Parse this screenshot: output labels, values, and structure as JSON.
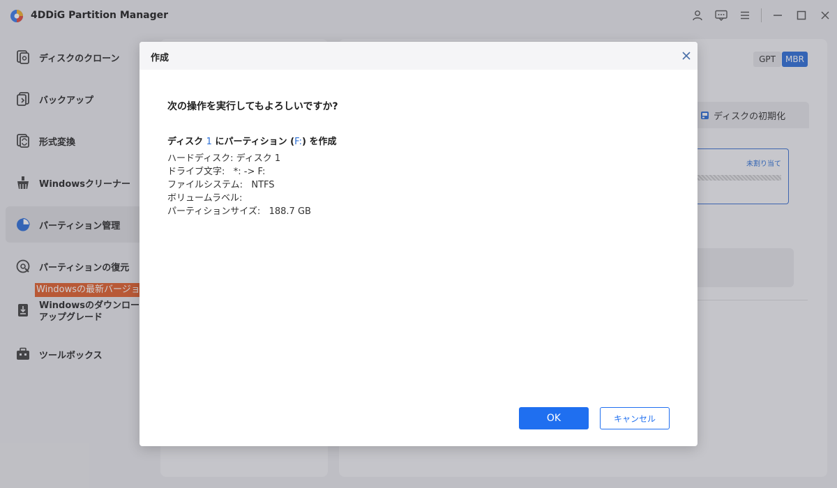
{
  "app": {
    "title": "4DDiG Partition Manager"
  },
  "titlebar_icons": [
    "user-icon",
    "feedback-icon",
    "menu-icon",
    "minimize-icon",
    "maximize-icon",
    "close-icon"
  ],
  "sidebar": {
    "items": [
      {
        "label": "ディスクのクローン",
        "icon": "disk-clone-icon"
      },
      {
        "label": "バックアップ",
        "icon": "backup-icon"
      },
      {
        "label": "形式変換",
        "icon": "format-convert-icon"
      },
      {
        "label": "Windowsクリーナー",
        "icon": "cleaner-icon"
      },
      {
        "label": "パーティション管理",
        "icon": "partition-pie-icon",
        "active": true
      },
      {
        "label": "パーティションの復元",
        "icon": "partition-recover-icon"
      },
      {
        "label_line1": "Windowsのダウンロード&",
        "label_line2": "アップグレード",
        "icon": "windows-download-icon"
      },
      {
        "label": "ツールボックス",
        "icon": "toolbox-icon"
      }
    ],
    "promo_badge": "Windowsの最新バージョン"
  },
  "right_panel": {
    "gpt": "GPT",
    "mbr": "MBR",
    "init_tab": "ディスクの初期化",
    "unallocated": "未割り当て"
  },
  "dialog": {
    "title": "作成",
    "question": "次の操作を実行してもよろしいですか?",
    "operation": {
      "prefix": "ディスク",
      "disk_num": "1",
      "middle": "にパーティション (",
      "drive": "F:",
      "suffix": ") を作成"
    },
    "details": [
      "ハードディスク: ディスク 1",
      "ドライブ文字:   *: -> F:",
      "ファイルシステム:   NTFS",
      "ボリュームラベル:",
      "パーティションサイズ:   188.7 GB"
    ],
    "ok_label": "OK",
    "cancel_label": "キャンセル"
  },
  "colors": {
    "accent": "#1f6ff0",
    "promo": "#e0612d",
    "mbr": "#2f6fd8"
  }
}
